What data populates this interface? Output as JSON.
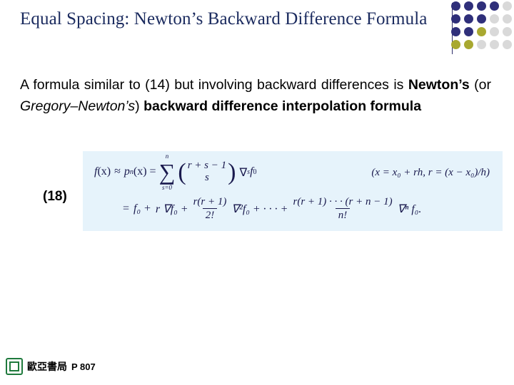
{
  "slide": {
    "title": "Equal Spacing: Newton’s Backward Difference Formula",
    "paragraph": {
      "seg1": "A formula similar to (14) but involving backward differences is ",
      "seg2_bold": "Newton’s",
      "seg3": " (or ",
      "seg4_italic": "Gregory–Newton’s",
      "seg5": ") ",
      "seg6_bold": "backward difference interpolation formula"
    },
    "equation_label": "(18)",
    "formula": {
      "lhs_f": "f",
      "lhs_x": "(x)",
      "approx": "≈",
      "p_n": "p",
      "p_sub": "n",
      "p_arg": "(x) =",
      "sum_symbol": "∑",
      "sum_upper": "n",
      "sum_lower": "s=0",
      "binom_top": "r + s − 1",
      "binom_bottom": "s",
      "nabla": "∇",
      "nabla_sup": "s",
      "nabla_f": "f",
      "nabla_sub": "0",
      "right_note": "(x = x₀ + rh, r = (x − x₀)/h)",
      "line2_eq": "=",
      "term_f0": "f₀ +",
      "term_rnabla": "r ∇f₀ +",
      "frac1_num": "r(r + 1)",
      "frac1_den": "2!",
      "frac1_tail": "∇²f₀ + · · · +",
      "frac2_num": "r(r + 1) · · · (r + n − 1)",
      "frac2_den": "n!",
      "frac2_tail": "∇ⁿ f₀."
    },
    "footer": {
      "publisher": "歐亞書局",
      "page": "P 807"
    },
    "colors": {
      "title": "#1a2a5e",
      "formula_background": "#e6f3fb",
      "math_text": "#1a1a4e",
      "dot_navy": "#2f2f7a",
      "dot_olive": "#a8a830",
      "dot_grey": "#d9d9d9",
      "logo_green": "#1f7a3d"
    }
  }
}
